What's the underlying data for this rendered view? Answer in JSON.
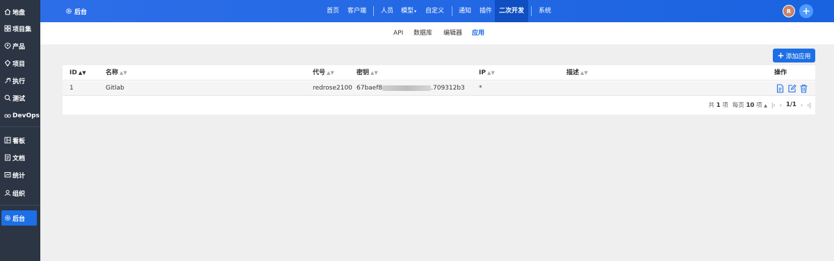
{
  "sidebar": {
    "items": [
      {
        "label": "地盘",
        "icon": "home-icon"
      },
      {
        "label": "项目集",
        "icon": "program-icon"
      },
      {
        "label": "产品",
        "icon": "product-icon"
      },
      {
        "label": "项目",
        "icon": "project-icon"
      },
      {
        "label": "执行",
        "icon": "execution-icon"
      },
      {
        "label": "测试",
        "icon": "test-icon"
      },
      {
        "label": "DevOps",
        "icon": "devops-icon"
      },
      {
        "label": "看板",
        "icon": "kanban-icon"
      },
      {
        "label": "文档",
        "icon": "doc-icon"
      },
      {
        "label": "统计",
        "icon": "stats-icon"
      },
      {
        "label": "组织",
        "icon": "org-icon"
      },
      {
        "label": "后台",
        "icon": "gear-icon"
      }
    ]
  },
  "header": {
    "brand": "后台",
    "nav": [
      "首页",
      "客户端",
      "人员",
      "模型",
      "自定义",
      "通知",
      "插件",
      "二次开发",
      "系统"
    ],
    "avatar": "R"
  },
  "subnav": [
    "API",
    "数据库",
    "编辑器",
    "应用"
  ],
  "toolbar": {
    "add_label": "添加应用"
  },
  "table": {
    "columns": [
      "ID",
      "名称",
      "代号",
      "密钥",
      "IP",
      "描述",
      "操作"
    ],
    "rows": [
      {
        "id": "1",
        "name": "Gitlab",
        "code": "redrose2100",
        "key_prefix": "67baef8",
        "key_suffix": ".709312b3",
        "ip": "*",
        "desc": ""
      }
    ]
  },
  "pager": {
    "total_prefix": "共",
    "total": "1",
    "total_suffix": "项",
    "per_page_prefix": "每页",
    "per_page": "10",
    "per_page_suffix": "项",
    "page": "1/1"
  }
}
